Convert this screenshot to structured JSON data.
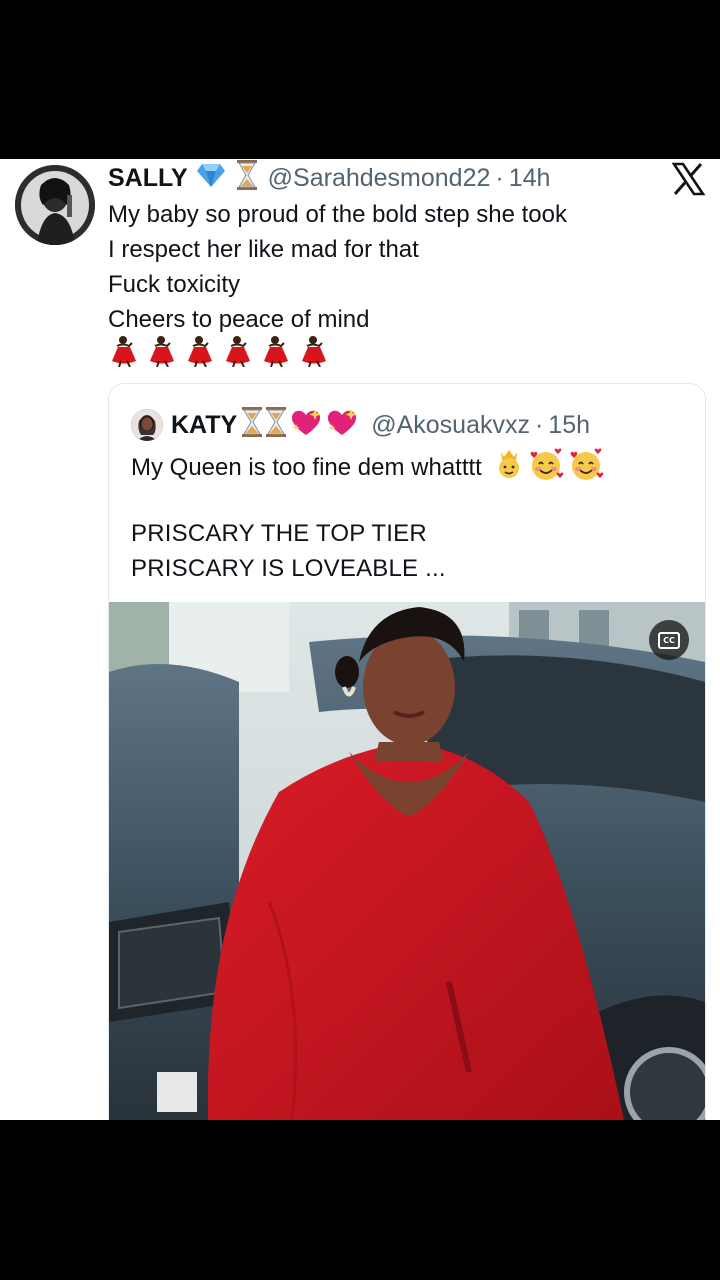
{
  "tweet": {
    "display_name": "SALLY",
    "badges": [
      "gem-icon",
      "hourglass-icon"
    ],
    "handle": "@Sarahdesmond22",
    "separator": "·",
    "time": "14h",
    "lines": [
      "My baby so proud of the bold step she took",
      "I respect her like mad for that",
      "Fuck toxicity",
      "Cheers to peace of mind"
    ],
    "emoji_row": [
      "dancer-icon",
      "dancer-icon",
      "dancer-icon",
      "dancer-icon",
      "dancer-icon",
      "dancer-icon"
    ]
  },
  "quote": {
    "display_name": "KATY",
    "badges": [
      "hourglass-icon",
      "hourglass-icon",
      "sparkling-heart-icon",
      "sparkling-heart-icon"
    ],
    "handle": "@Akosuakvxz",
    "separator": "·",
    "time": "15h",
    "text": "My Queen is too fine dem whatttt",
    "text_emojis": [
      "crown-face-icon",
      "smiling-face-hearts-icon",
      "smiling-face-hearts-icon"
    ],
    "line2": "PRISCARY THE TOP TIER",
    "line3": "PRISCARY IS LOVEABLE ...",
    "media": {
      "caption_button": "cc-icon",
      "cc_label": "CC"
    }
  },
  "colors": {
    "text": "#0f1419",
    "secondary": "#536471",
    "dress": "#c8141e",
    "background": "#ffffff"
  }
}
